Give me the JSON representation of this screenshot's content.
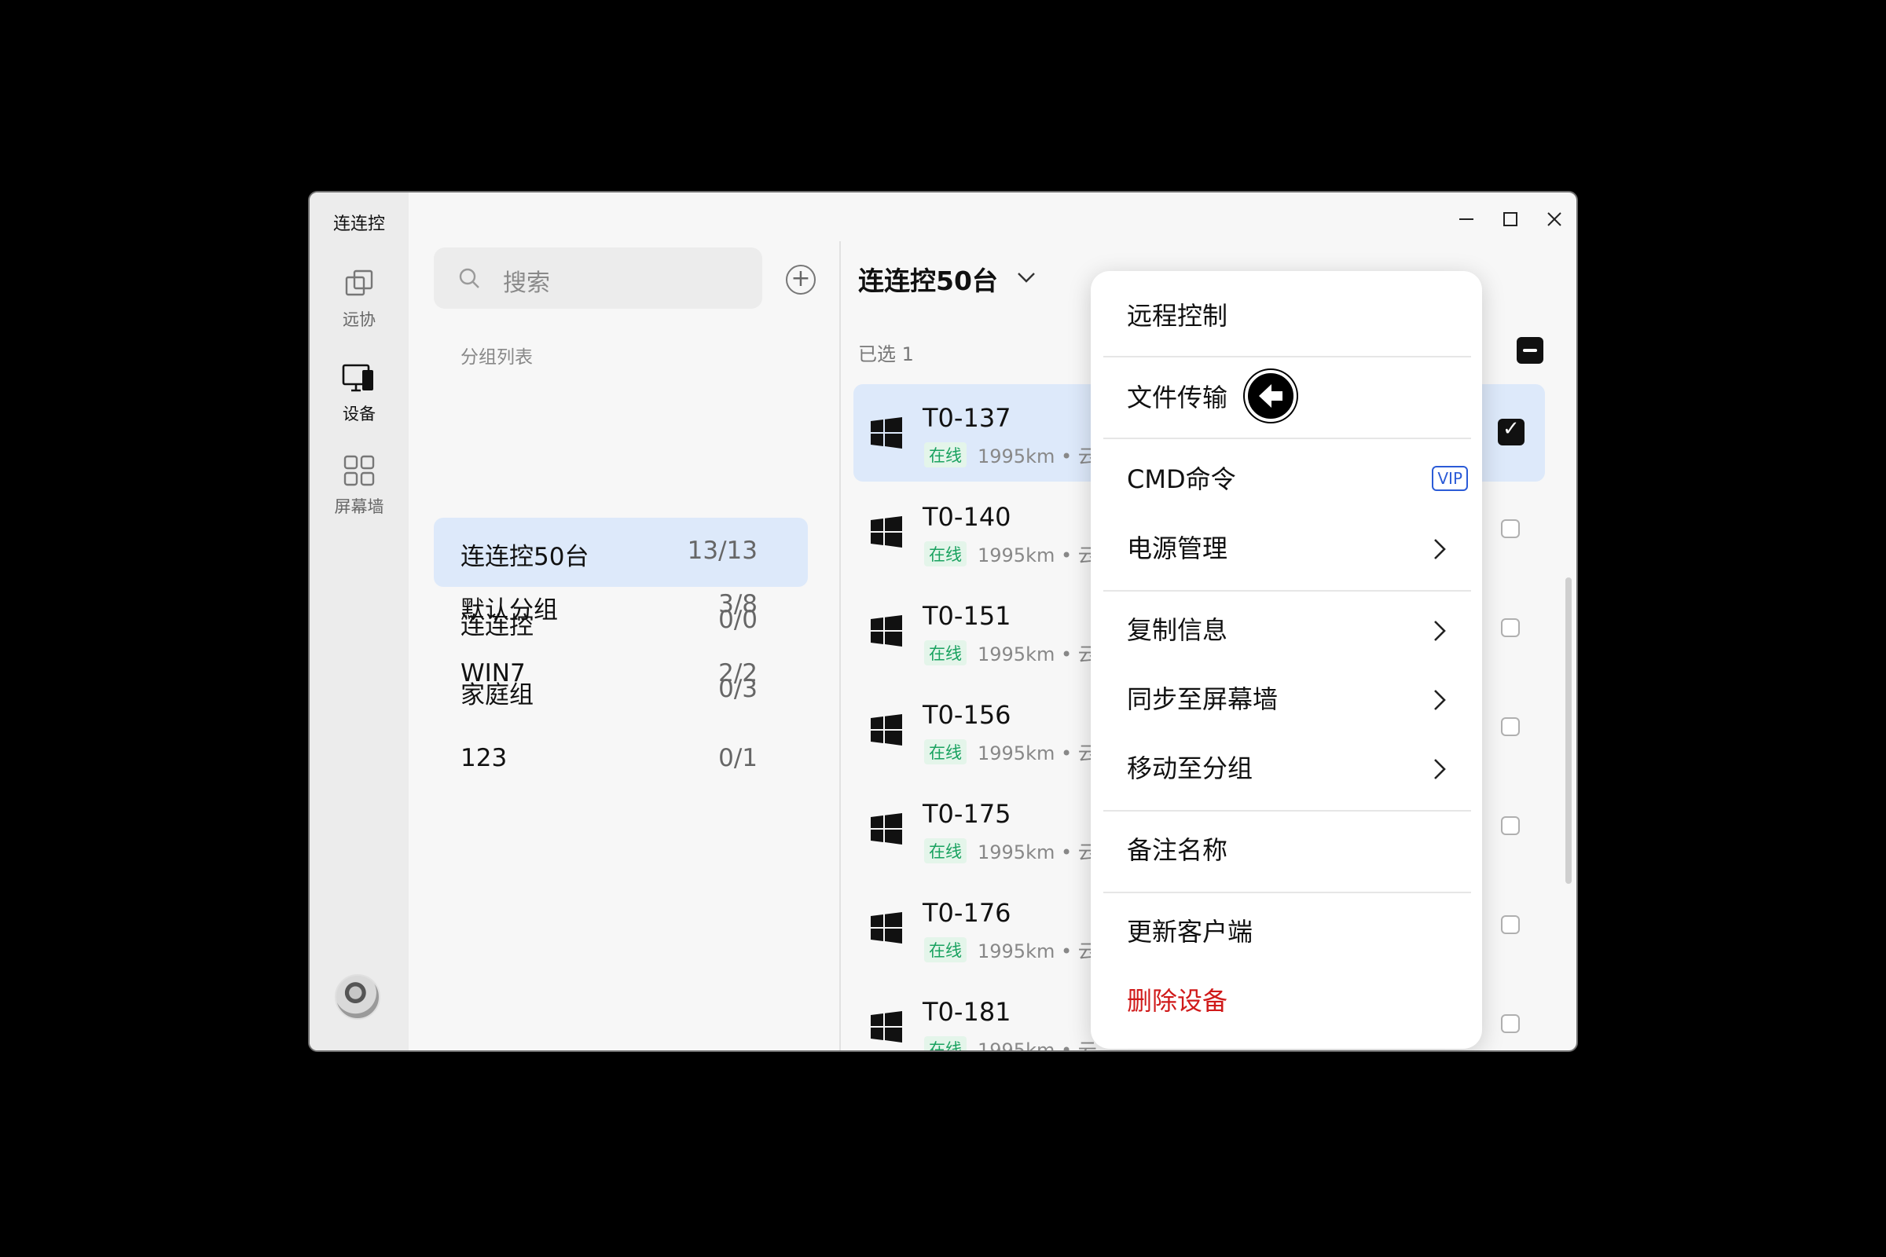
{
  "app": {
    "title": "连连控"
  },
  "window_controls": {
    "minimize": "—",
    "maximize": "□",
    "close": "✕"
  },
  "nav": {
    "items": [
      {
        "label": "远协",
        "icon": "remote-assist-icon"
      },
      {
        "label": "设备",
        "icon": "device-icon",
        "active": true
      },
      {
        "label": "屏幕墙",
        "icon": "grid-wall-icon"
      }
    ]
  },
  "groups": {
    "search_placeholder": "搜索",
    "header": "分组列表",
    "items": [
      {
        "name": "默认分组",
        "count": "3/8"
      },
      {
        "name": "WIN7",
        "count": "2/2"
      },
      {
        "name": "连连控50台",
        "count": "13/13",
        "selected": true
      },
      {
        "name": "连连控",
        "count": "0/0"
      },
      {
        "name": "家庭组",
        "count": "0/3"
      },
      {
        "name": "123",
        "count": "0/1"
      }
    ]
  },
  "devices": {
    "title": "连连控50台",
    "selected_count": "已选 1",
    "items": [
      {
        "name": "T0-137",
        "status": "在线",
        "meta": "1995km • 云",
        "selected": true
      },
      {
        "name": "T0-140",
        "status": "在线",
        "meta": "1995km • 云"
      },
      {
        "name": "T0-151",
        "status": "在线",
        "meta": "1995km • 云"
      },
      {
        "name": "T0-156",
        "status": "在线",
        "meta": "1995km • 云"
      },
      {
        "name": "T0-175",
        "status": "在线",
        "meta": "1995km • 云"
      },
      {
        "name": "T0-176",
        "status": "在线",
        "meta": "1995km • 云"
      },
      {
        "name": "T0-181",
        "status": "在线",
        "meta": "1995km • 云"
      }
    ]
  },
  "context_menu": {
    "items": [
      {
        "label": "远程控制"
      },
      {
        "label": "文件传输"
      },
      {
        "label": "CMD命令",
        "badge": "VIP"
      },
      {
        "label": "电源管理",
        "submenu": true
      },
      {
        "label": "复制信息",
        "submenu": true
      },
      {
        "label": "同步至屏幕墙",
        "submenu": true
      },
      {
        "label": "移动至分组",
        "submenu": true
      },
      {
        "label": "备注名称"
      },
      {
        "label": "更新客户端"
      },
      {
        "label": "删除设备",
        "danger": true
      }
    ]
  },
  "colors": {
    "accent_selected": "#dde9fa",
    "online_green": "#1aa260",
    "danger_red": "#d01a1a",
    "vip_blue": "#2b5bd7"
  }
}
